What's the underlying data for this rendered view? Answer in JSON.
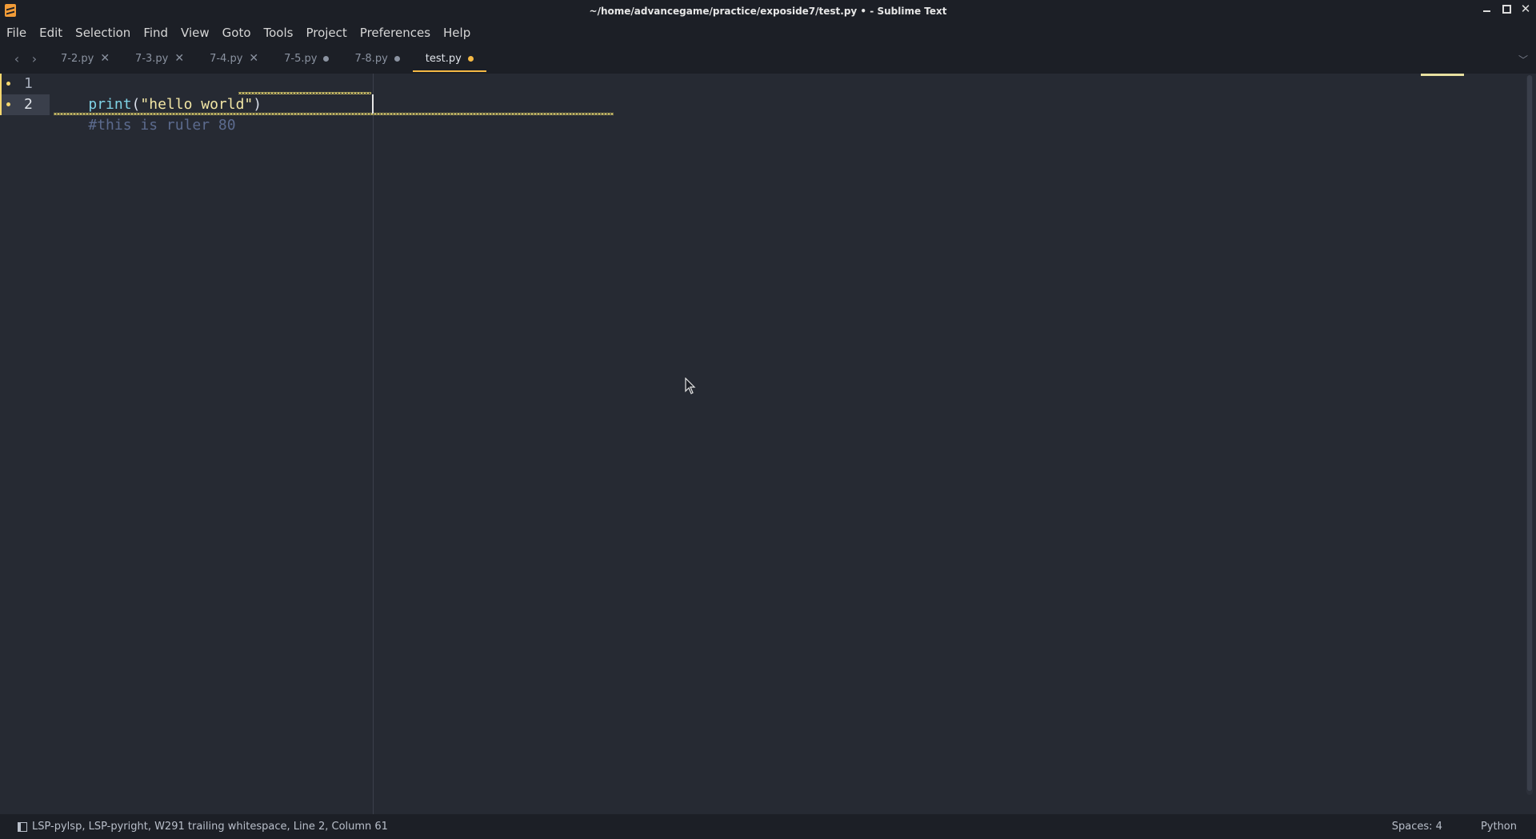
{
  "window": {
    "title": "~/home/advancegame/practice/exposide7/test.py • - Sublime Text"
  },
  "menu": [
    "File",
    "Edit",
    "Selection",
    "Find",
    "View",
    "Goto",
    "Tools",
    "Project",
    "Preferences",
    "Help"
  ],
  "tabs": [
    {
      "label": "7-2.py",
      "state": "saved"
    },
    {
      "label": "7-3.py",
      "state": "saved"
    },
    {
      "label": "7-4.py",
      "state": "saved"
    },
    {
      "label": "7-5.py",
      "state": "modified"
    },
    {
      "label": "7-8.py",
      "state": "modified"
    },
    {
      "label": "test.py",
      "state": "modified",
      "active": true
    }
  ],
  "editor": {
    "lines": [
      {
        "number": "1",
        "tokens": {
          "fn": "print",
          "open": "(",
          "str": "\"hello world\"",
          "close": ")"
        }
      },
      {
        "number": "2",
        "comment": "#this is ruler 80"
      }
    ],
    "current_line": 2,
    "ruler_column": 80
  },
  "status": {
    "message": "LSP-pylsp, LSP-pyright, W291 trailing whitespace, Line 2, Column 61",
    "indent": "Spaces: 4",
    "syntax": "Python"
  },
  "colors": {
    "accent": "#f5b945",
    "background": "#262a33",
    "chrome": "#1c1f26"
  }
}
